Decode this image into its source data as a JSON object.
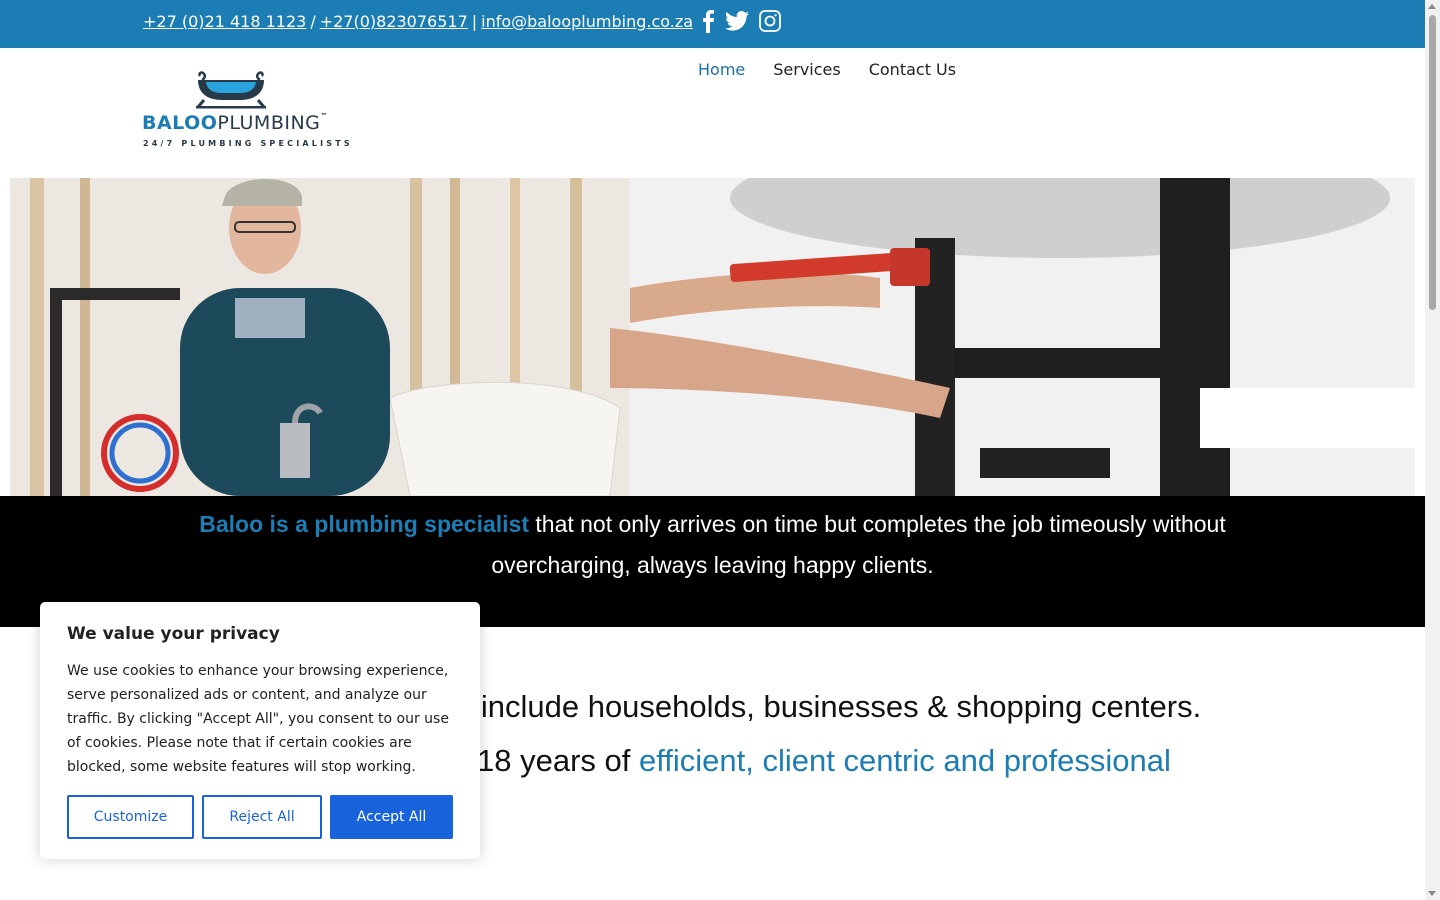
{
  "topbar": {
    "phone1": "+27 (0)21 418 1123",
    "sep1": "/",
    "phone2": "+27(0)823076517",
    "sep2": "|",
    "email": "info@balooplumbing.co.za",
    "background": "#1b7db3"
  },
  "social": [
    "facebook-icon",
    "twitter-icon",
    "instagram-icon"
  ],
  "logo": {
    "word_part1": "BALOO",
    "word_part2": "PLUMBING",
    "trademark": "™",
    "tagline": "24/7 PLUMBING SPECIALISTS"
  },
  "nav": {
    "items": [
      {
        "label": "Home",
        "active": true
      },
      {
        "label": "Services",
        "active": false
      },
      {
        "label": "Contact Us",
        "active": false
      }
    ]
  },
  "banner": {
    "highlight": "Baloo is a plumbing specialist",
    "text": " that not only arrives on time but completes the job timeously without overcharging, always leaving happy clients."
  },
  "content": {
    "line1": "e include households, businesses & shopping centers.",
    "line2_a": "18 years of ",
    "line2_highlight": "efficient, client centric and professional",
    "line3": "t."
  },
  "cookie": {
    "title": "We value your privacy",
    "body": "We use cookies to enhance your browsing experience, serve personalized ads or content, and analyze our traffic. By clicking \"Accept All\", you consent to our use of cookies. Please note that if certain cookies are blocked, some website features will stop working.",
    "customize": "Customize",
    "reject": "Reject All",
    "accept": "Accept All",
    "accent": "#1863dc"
  }
}
